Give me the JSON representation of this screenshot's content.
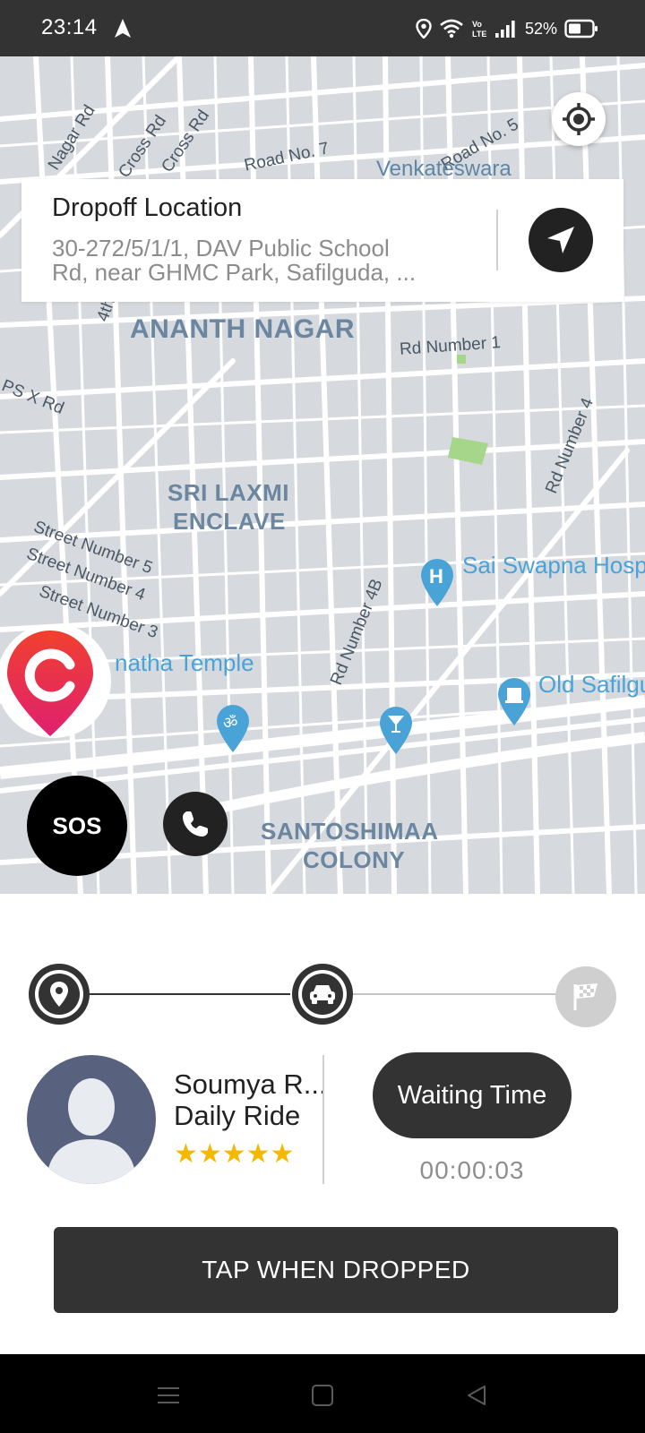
{
  "status_bar": {
    "time": "23:14",
    "battery_percent": "52%",
    "battery_level": 0.52,
    "icons": [
      "navigation-arrow-icon",
      "location-icon",
      "wifi-icon",
      "volte-icon",
      "signal-icon",
      "battery-icon"
    ]
  },
  "map": {
    "area_labels": [
      "ANANTH NAGAR",
      "SRI LAXMI",
      "ENCLAVE",
      "SANTOSHIMAA",
      "COLONY"
    ],
    "road_labels": [
      "Road No. 7",
      "Road No. 5",
      "Venkateswara",
      "Rd Number 1",
      "Rd Number 4",
      "Rd Number 4B",
      "Street Number 5",
      "Street Number 4",
      "Street Number 3",
      "PS X Rd",
      "Cross Rd",
      "Cross Rd",
      "Nagar Rd",
      "4th"
    ],
    "poi_labels": [
      "Sai Swapna Hosp",
      "Old Safilgu",
      "natha Temple"
    ],
    "poi_icons": [
      "hospital-pin-icon",
      "temple-pin-icon",
      "bar-pin-icon",
      "landmark-pin-icon"
    ]
  },
  "dropoff": {
    "title": "Dropoff Location",
    "address_line1": "30-272/5/1/1, DAV Public School",
    "address_line2": "Rd, near GHMC Park, Safilguda, ..."
  },
  "sos": {
    "label": "SOS"
  },
  "progress": {
    "steps": [
      "pickup",
      "in-ride",
      "dropoff"
    ],
    "current_step": 2
  },
  "rider": {
    "name": "Soumya R...",
    "ride_type": "Daily Ride",
    "rating": 5,
    "stars": "★★★★★"
  },
  "waiting": {
    "label": "Waiting Time",
    "time": "00:00:03"
  },
  "action": {
    "label": "TAP WHEN DROPPED"
  },
  "colors": {
    "dark": "#333333",
    "map_bg": "#d6d9dd",
    "star": "#f5b800",
    "poi": "#4aa3d6",
    "brand": "#e8354a"
  }
}
